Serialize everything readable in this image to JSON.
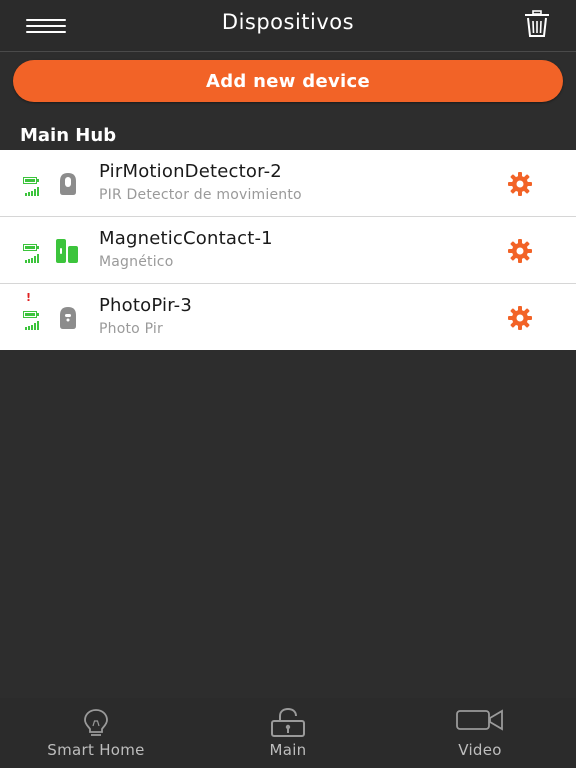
{
  "header": {
    "title": "Dispositivos",
    "menu_icon": "hamburger-menu-icon",
    "trash_icon": "trash-icon"
  },
  "actions": {
    "add_device_label": "Add new device"
  },
  "section": {
    "title": "Main Hub"
  },
  "devices": [
    {
      "name": "PirMotionDetector-2",
      "type": "PIR Detector de movimiento",
      "icon": "pir-sensor-icon",
      "icon_color": "#8c8c8c",
      "alert": false
    },
    {
      "name": "MagneticContact-1",
      "type": "Magnético",
      "icon": "magnetic-contact-icon",
      "icon_color": "#3cc43c",
      "alert": false
    },
    {
      "name": "PhotoPir-3",
      "type": "Photo Pir",
      "icon": "photo-pir-icon",
      "icon_color": "#8c8c8c",
      "alert": true,
      "alert_mark": "!"
    }
  ],
  "tabs": [
    {
      "label": "Smart Home",
      "icon": "lightbulb-icon"
    },
    {
      "label": "Main",
      "icon": "unlocked-padlock-icon"
    },
    {
      "label": "Video",
      "icon": "video-camera-icon"
    }
  ],
  "colors": {
    "background": "#2d2d2d",
    "accent": "#f26327",
    "status_ok": "#3cc43c",
    "alert": "#e02020",
    "row_background": "#ffffff",
    "tab_label": "#bdbdbd"
  }
}
